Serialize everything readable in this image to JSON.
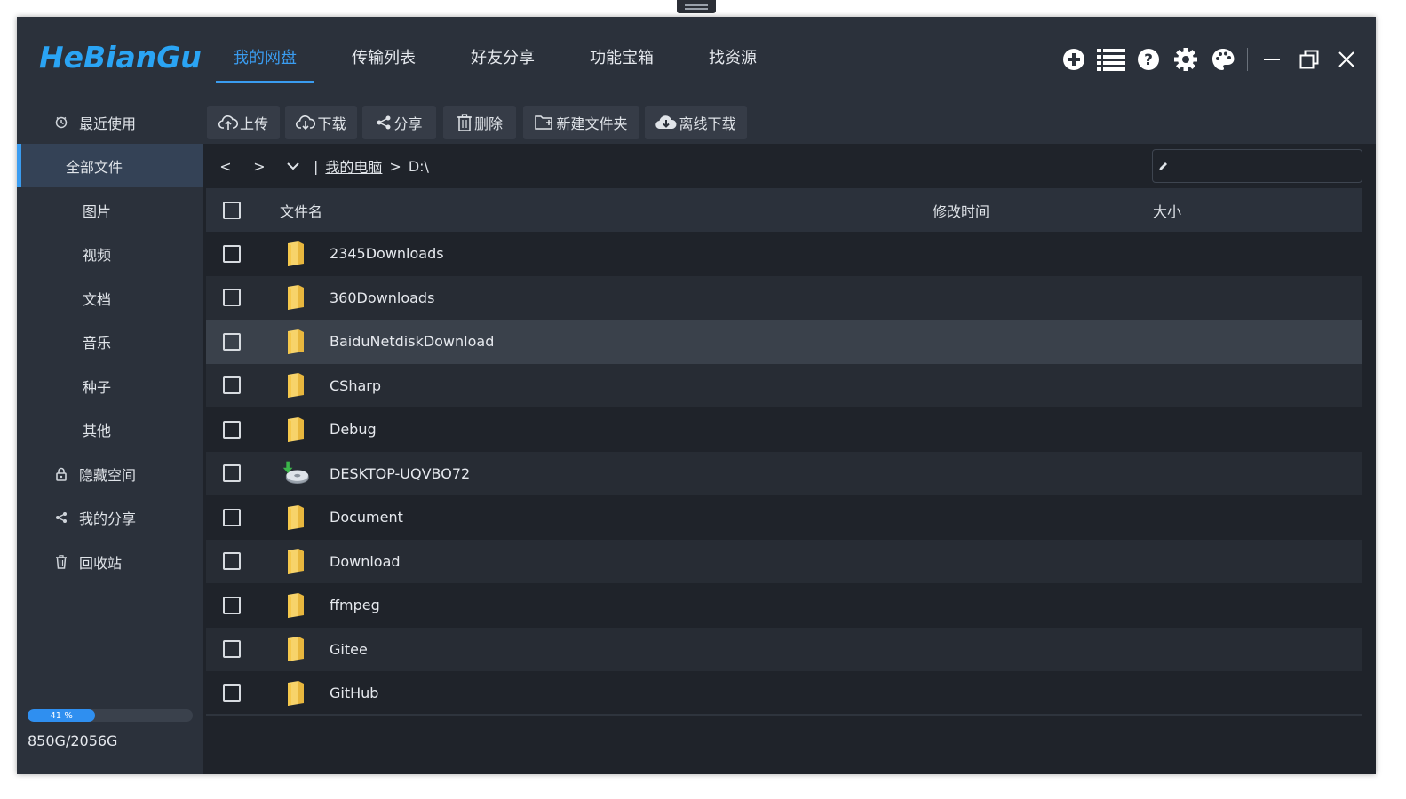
{
  "app": {
    "logo": "HeBianGu"
  },
  "nav_tabs": [
    {
      "label": "我的网盘",
      "active": true
    },
    {
      "label": "传输列表",
      "active": false
    },
    {
      "label": "好友分享",
      "active": false
    },
    {
      "label": "功能宝箱",
      "active": false
    },
    {
      "label": "找资源",
      "active": false
    }
  ],
  "title_icons": [
    "add-icon",
    "list-icon",
    "help-icon",
    "settings-icon",
    "palette-icon",
    "minimize-icon",
    "restore-icon",
    "close-icon"
  ],
  "sidebar": {
    "items": [
      {
        "label": "最近使用",
        "icon": "clock-icon"
      },
      {
        "label": "全部文件",
        "active": true
      },
      {
        "label": "图片"
      },
      {
        "label": "视频"
      },
      {
        "label": "文档"
      },
      {
        "label": "音乐"
      },
      {
        "label": "种子"
      },
      {
        "label": "其他"
      },
      {
        "label": "隐藏空间",
        "icon": "lock-icon"
      },
      {
        "label": "我的分享",
        "icon": "share-icon"
      },
      {
        "label": "回收站",
        "icon": "trash-icon"
      }
    ],
    "quota": {
      "percent_label": "41 %",
      "fraction": 0.41,
      "text": "850G/2056G"
    }
  },
  "toolbar": {
    "upload": "上传",
    "download": "下载",
    "share": "分享",
    "delete": "删除",
    "new_folder": "新建文件夹",
    "offline_download": "离线下载"
  },
  "pathbar": {
    "back": "<",
    "forward": ">",
    "divider": "|",
    "crumb_root": "我的电脑",
    "crumb_sep": ">",
    "crumb_current": "D:\\",
    "search_placeholder": ""
  },
  "table": {
    "headers": {
      "name": "文件名",
      "mtime": "修改时间",
      "size": "大小"
    },
    "rows": [
      {
        "name": "2345Downloads",
        "type": "folder"
      },
      {
        "name": "360Downloads",
        "type": "folder"
      },
      {
        "name": "BaiduNetdiskDownload",
        "type": "folder",
        "selected": true
      },
      {
        "name": "CSharp",
        "type": "folder"
      },
      {
        "name": "Debug",
        "type": "folder"
      },
      {
        "name": "DESKTOP-UQVBO72",
        "type": "network-drive"
      },
      {
        "name": "Document",
        "type": "folder"
      },
      {
        "name": "Download",
        "type": "folder"
      },
      {
        "name": "ffmpeg",
        "type": "folder"
      },
      {
        "name": "Gitee",
        "type": "folder"
      },
      {
        "name": "GitHub",
        "type": "folder"
      }
    ]
  },
  "colors": {
    "accent": "#3a9cf0",
    "folder": "#f5c84c",
    "background": "#1f232a"
  }
}
